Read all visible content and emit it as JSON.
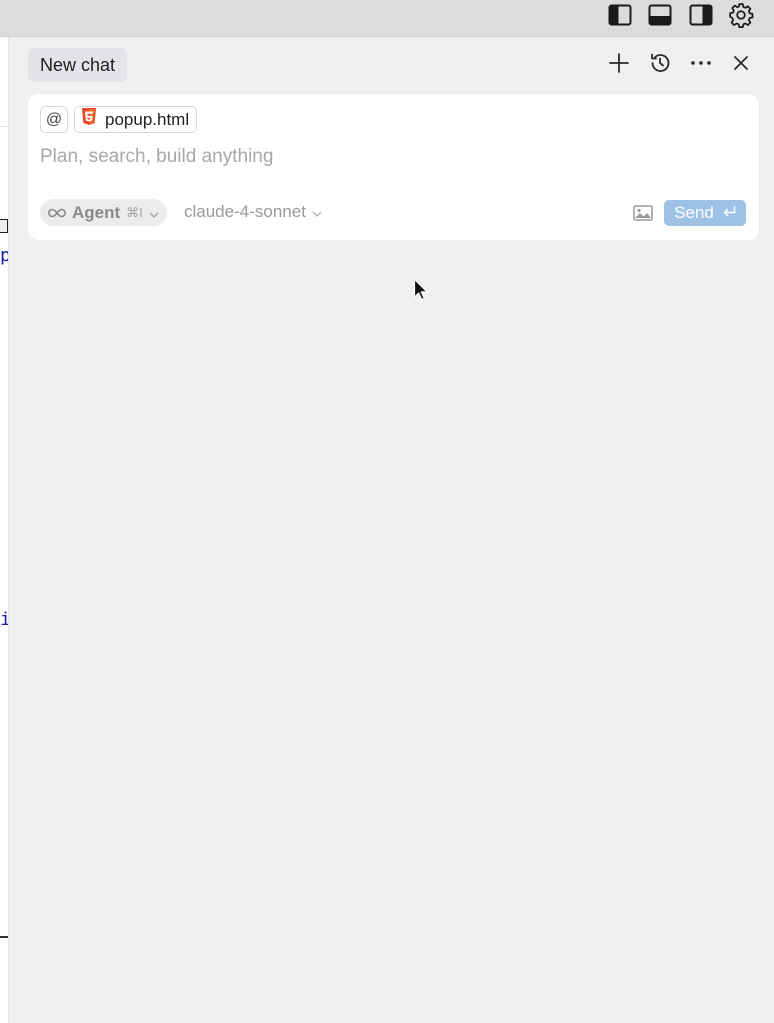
{
  "topbar": {
    "icons": [
      "toggle-left-sidebar-icon",
      "toggle-bottom-panel-icon",
      "toggle-right-sidebar-icon",
      "gear-icon"
    ]
  },
  "editor": {
    "visible_glyphs": [
      "p",
      "i"
    ]
  },
  "chat": {
    "tab_label": "New chat",
    "header_icons": [
      "plus-icon",
      "history-icon",
      "more-icon",
      "close-icon"
    ],
    "context": {
      "at_symbol": "@",
      "file_name": "popup.html",
      "file_icon": "html5-icon"
    },
    "input_placeholder": "Plan, search, build anything",
    "mode": {
      "icon": "infinity-icon",
      "label": "Agent",
      "shortcut": "⌘I"
    },
    "model": "claude-4-sonnet",
    "send_label": "Send",
    "colors": {
      "send_bg": "#9ec2e6",
      "panel_bg": "#f0f0f0",
      "tab_bg": "#e3e3e8",
      "html_icon": "#e34c26"
    }
  }
}
